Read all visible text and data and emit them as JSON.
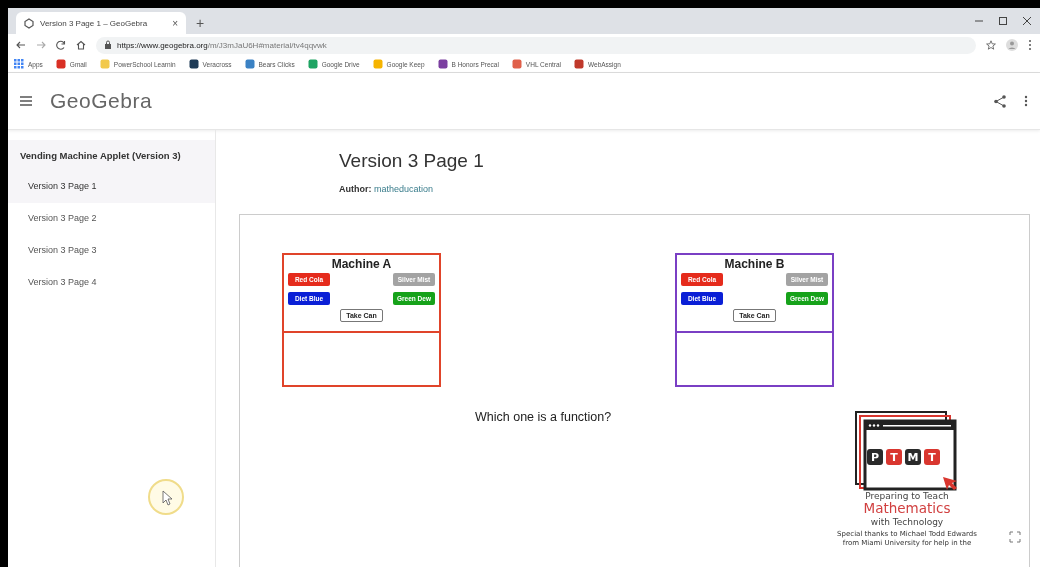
{
  "browser": {
    "tab": {
      "title": "Version 3 Page 1 – GeoGebra",
      "close": "×",
      "new_tab": "+"
    },
    "url": {
      "host": "https://www.geogebra.org",
      "path": "/m/J3mJaU6H#material/tv4qqvwk"
    },
    "bookmarks": [
      {
        "label": "Apps",
        "color": "#4285f4"
      },
      {
        "label": "Gmail",
        "color": "#d93025"
      },
      {
        "label": "PowerSchool Learnin",
        "color": "#f2c94c"
      },
      {
        "label": "Veracross",
        "color": "#1f3b57"
      },
      {
        "label": "Bears Clicks",
        "color": "#3b82c4"
      },
      {
        "label": "Google Drive",
        "color": "#1fa463"
      },
      {
        "label": "Google Keep",
        "color": "#f6b400"
      },
      {
        "label": "B Honors Precal",
        "color": "#7b3fa0"
      },
      {
        "label": "VHL Central",
        "color": "#e0604a"
      },
      {
        "label": "WebAssign",
        "color": "#c0392b"
      }
    ]
  },
  "app": {
    "logo": "GeoGebra"
  },
  "sidebar": {
    "title": "Vending Machine Applet (Version 3)",
    "items": [
      {
        "label": "Version 3 Page 1",
        "selected": true
      },
      {
        "label": "Version 3 Page 2",
        "selected": false
      },
      {
        "label": "Version 3 Page 3",
        "selected": false
      },
      {
        "label": "Version 3 Page 4",
        "selected": false
      }
    ]
  },
  "page": {
    "title": "Version 3 Page 1",
    "author_label": "Author:",
    "author": "matheducation"
  },
  "applet": {
    "machines": [
      {
        "title": "Machine A",
        "color": "#e0442a",
        "cans": [
          {
            "label": "Red Cola",
            "color": "#e52b1c"
          },
          {
            "label": "Silver Mist",
            "color": "#a3a3a3"
          },
          {
            "label": "Diet Blue",
            "color": "#0a1fd6"
          },
          {
            "label": "Green Dew",
            "color": "#16a21a"
          }
        ],
        "action": "Take Can"
      },
      {
        "title": "Machine B",
        "color": "#7a3fc4",
        "cans": [
          {
            "label": "Red Cola",
            "color": "#e52b1c"
          },
          {
            "label": "Silver Mist",
            "color": "#a3a3a3"
          },
          {
            "label": "Diet Blue",
            "color": "#0a1fd6"
          },
          {
            "label": "Green Dew",
            "color": "#16a21a"
          }
        ],
        "action": "Take Can"
      }
    ],
    "question": "Which one is a function?",
    "logo": {
      "tiles": [
        {
          "letter": "P",
          "color": "#2a2a2a"
        },
        {
          "letter": "T",
          "color": "#d9362f"
        },
        {
          "letter": "M",
          "color": "#2a2a2a"
        },
        {
          "letter": "T",
          "color": "#d9362f"
        }
      ],
      "lines": [
        {
          "text": "Preparing to Teach",
          "kind": "plain"
        },
        {
          "text": "Mathematics",
          "kind": "accent"
        },
        {
          "text": "with Technology",
          "kind": "plain"
        }
      ],
      "credit": [
        "Special thanks to Michael Todd Edwards",
        "from Miami University for help in the"
      ]
    }
  }
}
